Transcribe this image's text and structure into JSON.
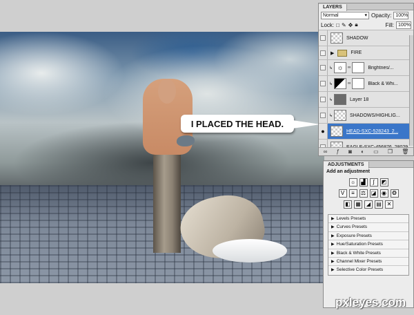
{
  "callout": {
    "text": "I PLACED THE HEAD."
  },
  "layers_panel": {
    "tab": "LAYERS",
    "blend_mode": "Normal",
    "opacity_label": "Opacity:",
    "opacity_value": "100%",
    "lock_label": "Lock:",
    "fill_label": "Fill:",
    "fill_value": "100%",
    "layers": [
      {
        "name": "SHADOW"
      },
      {
        "name": "FIRE"
      },
      {
        "name": "Brightnes/..."
      },
      {
        "name": "Black & Whi..."
      },
      {
        "name": "Layer 18"
      },
      {
        "name": "SHADOWS/HIGHLIG..."
      },
      {
        "name": "HEAD-SXC-528243_2..."
      },
      {
        "name": "EAGLE-SXC-456876_28029..."
      }
    ]
  },
  "adjustments_panel": {
    "tab": "ADJUSTMENTS",
    "heading": "Add an adjustment",
    "presets": [
      "Levels Presets",
      "Curves Presets",
      "Exposure Presets",
      "Hue/Saturation Presets",
      "Black & White Presets",
      "Channel Mixer Presets",
      "Selective Color Presets"
    ]
  },
  "watermark": {
    "text": "pxleyes.com"
  },
  "icons": [
    "eye-icon",
    "folder-icon",
    "brightness-icon",
    "levels-icon",
    "curves-icon",
    "exposure-icon",
    "lock-icon",
    "link-icon"
  ]
}
